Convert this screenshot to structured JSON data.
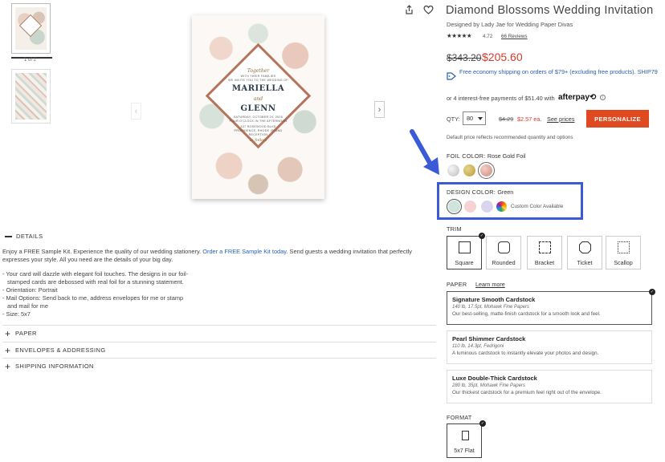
{
  "gallery": {
    "pager": "1 of 2",
    "card": {
      "together": "Together",
      "line1": "WITH THEIR FAMILIES",
      "line2": "WE INVITE YOU TO THE WEDDING OF",
      "name1": "MARIELLA",
      "and": "and",
      "name2": "GLENN",
      "line3": "SATURDAY, OCTOBER 24, 2025",
      "line4": "FOUR O'CLOCK IN THE AFTERNOON",
      "line5": "437 ROSEWOOD BLVD",
      "line6": "PROVIDENCE, RHODE ISLAND",
      "line7": "RECEPTION",
      "follow": "to follow"
    }
  },
  "details": {
    "heading": "DETAILS",
    "intro_before": "Enjoy a FREE Sample Kit. Experience the quality of our wedding stationery. ",
    "intro_link": "Order a FREE Sample Kit today",
    "intro_after": ". Send guests a wedding invitation that perfectly expresses your style. All you need are the details of your big day.",
    "bullets": [
      "- Your card will dazzle with elegant foil touches. The designs in our foil-",
      "  stamped cards are debossed with real foil for a stunning statement.",
      "- Orientation: Portrait",
      "- Mail Options: Send back to me, address envelopes for me or stamp",
      "  and mail for me",
      "- Size: 5x7"
    ],
    "accordions": [
      "PAPER",
      "ENVELOPES & ADDRESSING",
      "SHIPPING INFORMATION"
    ]
  },
  "product": {
    "title": "Diamond Blossoms Wedding Invitation",
    "designer": "Designed by Lady Jae for Wedding Paper Divas",
    "stars": "★★★★★",
    "rating": "4.72",
    "reviews": "66 Reviews",
    "old_price": "$343.20",
    "new_price": "$205.60",
    "shipping": "Free economy shipping on orders of $79+ (excluding free products). SHIP79",
    "installments": "or 4 interest-free payments of $51.40 with",
    "afterpay": "afterpay⟲",
    "info": "i",
    "qty_label": "QTY:",
    "qty_value": "80",
    "each_old": "$4.29",
    "each_new": "$2.57 ea.",
    "see_prices": "See prices",
    "personalize": "PERSONALIZE",
    "default_note": "Default price reflects recommended quantity and options"
  },
  "foil": {
    "label": "FOIL COLOR:",
    "value": "Rose Gold Foil"
  },
  "design_color": {
    "label": "DESIGN COLOR:",
    "value": "Green",
    "custom": "Custom Color Available"
  },
  "trim": {
    "label": "TRIM",
    "options": [
      "Square",
      "Rounded",
      "Bracket",
      "Ticket",
      "Scallop"
    ]
  },
  "paper": {
    "label": "PAPER",
    "learn_more": "Learn more",
    "options": [
      {
        "name": "Signature Smooth Cardstock",
        "spec": "140 lb, 17.5pt, Mohawk Fine Papers",
        "desc": "Our best-selling, matte-finish cardstock for a smooth look and feel."
      },
      {
        "name": "Pearl Shimmer Cardstock",
        "spec": "110 lb, 14.3pt, Fedrigoni",
        "desc": "A luminous cardstock to instantly elevate your photos and design."
      },
      {
        "name": "Luxe Double-Thick Cardstock",
        "spec": "280 lb, 35pt, Mohawk Fine Papers",
        "desc": "Our thickest cardstock for a premium feel right out of the envelope."
      }
    ]
  },
  "format": {
    "label": "FORMAT",
    "option": "5x7 Flat"
  },
  "colors": {
    "accent": "#e04a20",
    "sale": "#d63a2b",
    "link": "#2a5ea8",
    "highlight": "#3b5bd6"
  },
  "icons": {
    "share": "share-icon",
    "favorite": "heart-icon",
    "check": "✓"
  }
}
